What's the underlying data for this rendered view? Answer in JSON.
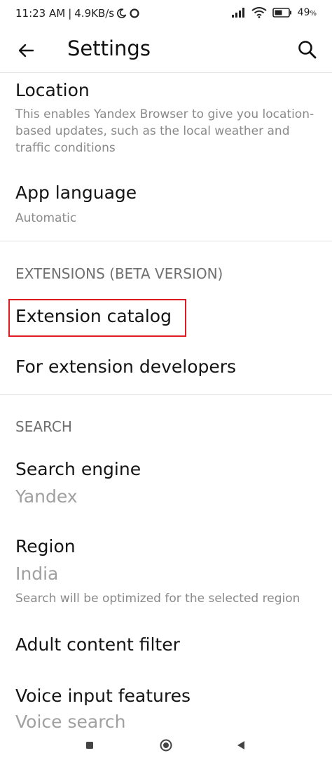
{
  "status_bar": {
    "time": "11:23 AM",
    "speed": "4.9KB/s",
    "battery": "49"
  },
  "header": {
    "title": "Settings"
  },
  "items": {
    "location": {
      "title": "Location",
      "subtitle": "This enables Yandex Browser to give you location-based updates, such as the local weather and traffic conditions"
    },
    "app_language": {
      "title": "App language",
      "subtitle": "Automatic"
    },
    "extensions_header": "EXTENSIONS (BETA VERSION)",
    "extension_catalog": "Extension catalog",
    "for_developers": "For extension developers",
    "search_header": "SEARCH",
    "search_engine": {
      "title": "Search engine",
      "value": "Yandex"
    },
    "region": {
      "title": "Region",
      "value": "India",
      "subtitle": "Search will be optimized for the selected region"
    },
    "adult_filter": "Adult content filter",
    "voice_input": {
      "title": "Voice input features",
      "value": "Voice search"
    }
  },
  "colors": {
    "highlight": "#e01b24"
  },
  "icons": {
    "back": "arrow-left-icon",
    "search": "search-icon",
    "nav_recents": "square-icon",
    "nav_home": "circle-icon",
    "nav_back": "triangle-icon"
  }
}
